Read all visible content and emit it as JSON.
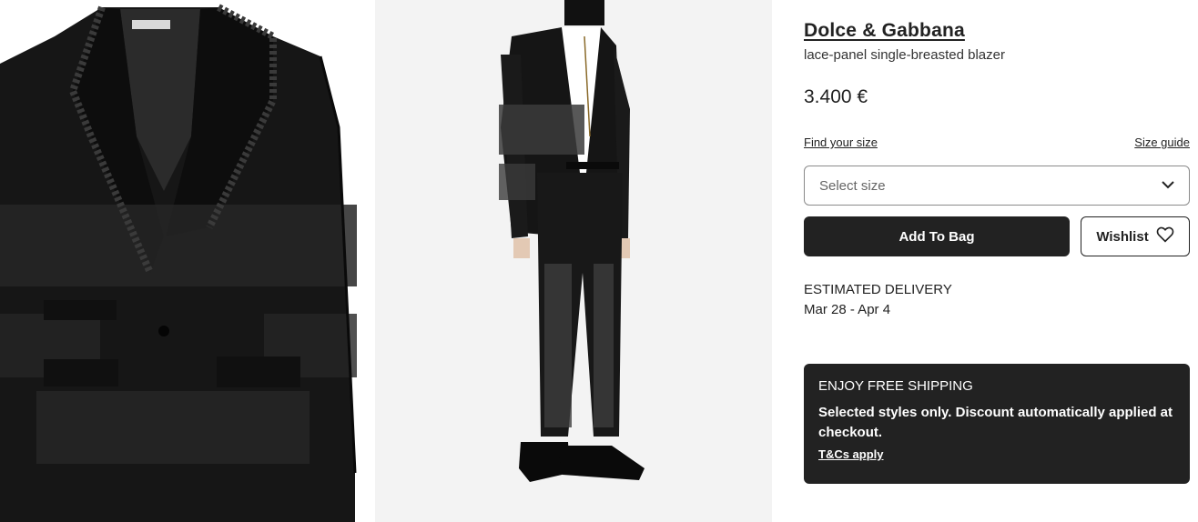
{
  "product": {
    "brand": "Dolce & Gabbana",
    "name": "lace-panel single-breasted blazer",
    "price": "3.400 €"
  },
  "size": {
    "find_label": "Find your size",
    "guide_label": "Size guide",
    "select_placeholder": "Select size"
  },
  "actions": {
    "add_to_bag": "Add To Bag",
    "wishlist": "Wishlist"
  },
  "delivery": {
    "label": "ESTIMATED DELIVERY",
    "dates": "Mar 28 - Apr 4"
  },
  "promo": {
    "title": "ENJOY FREE SHIPPING",
    "text": "Selected styles only. Discount automatically applied at checkout.",
    "link": "T&Cs apply"
  },
  "icons": {
    "select": "chevron-down-icon",
    "wishlist": "heart-icon"
  },
  "colors": {
    "primary": "#222222",
    "image_bg": "#f3f3f3"
  }
}
